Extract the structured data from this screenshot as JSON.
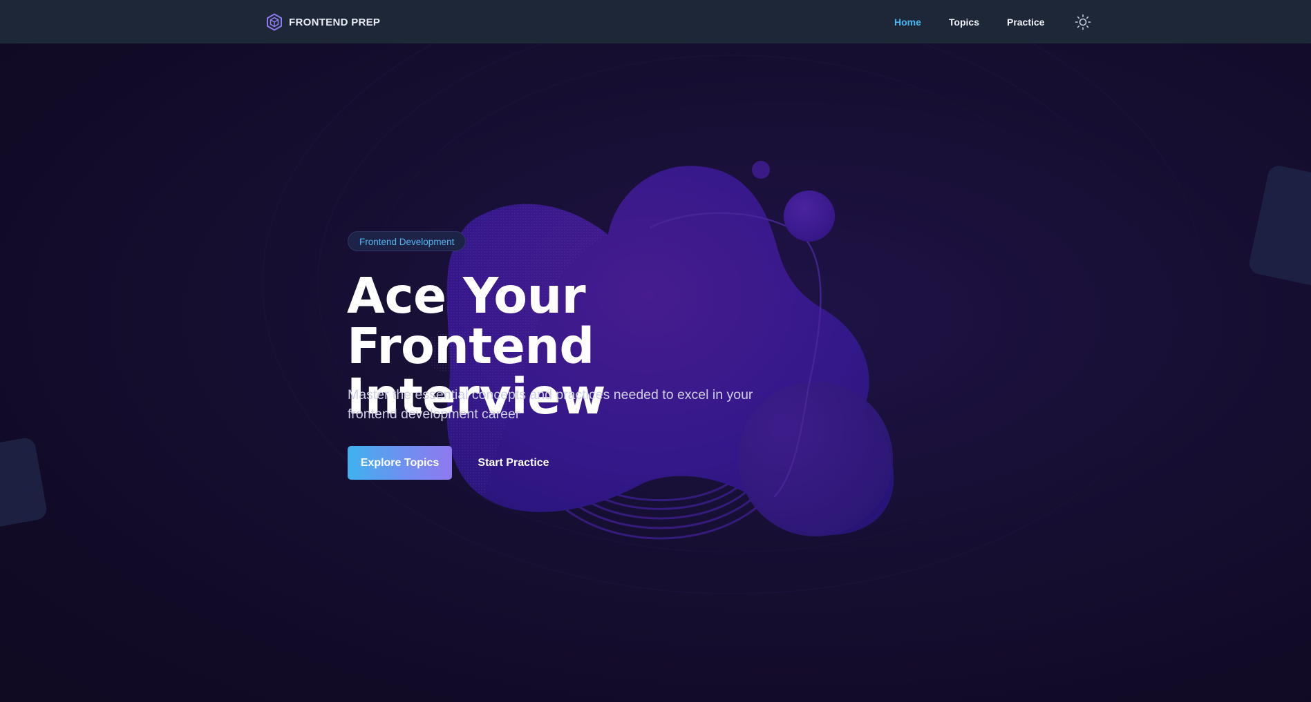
{
  "navbar": {
    "brand": {
      "logo_icon": "hexagon-cube-icon",
      "name": "FRONTEND PREP"
    },
    "links": [
      {
        "label": "Home",
        "active": true
      },
      {
        "label": "Topics",
        "active": false
      },
      {
        "label": "Practice",
        "active": false
      }
    ],
    "theme_toggle_icon": "sun-icon"
  },
  "hero": {
    "badge": "Frontend Development",
    "title_line1": "Ace Your Frontend",
    "title_line2": "Interview",
    "subtitle_line1": "Master the essential concepts and practices needed to excel in your",
    "subtitle_line2": "frontend development career",
    "primary_button": "Explore Topics",
    "secondary_button": "Start Practice"
  },
  "colors": {
    "navbar_bg": "#1e2738",
    "page_bg": "#140e2a",
    "accent_blue": "#46b5f0",
    "accent_purple": "#8f79ef",
    "blob_purple": "#3a1a84"
  }
}
